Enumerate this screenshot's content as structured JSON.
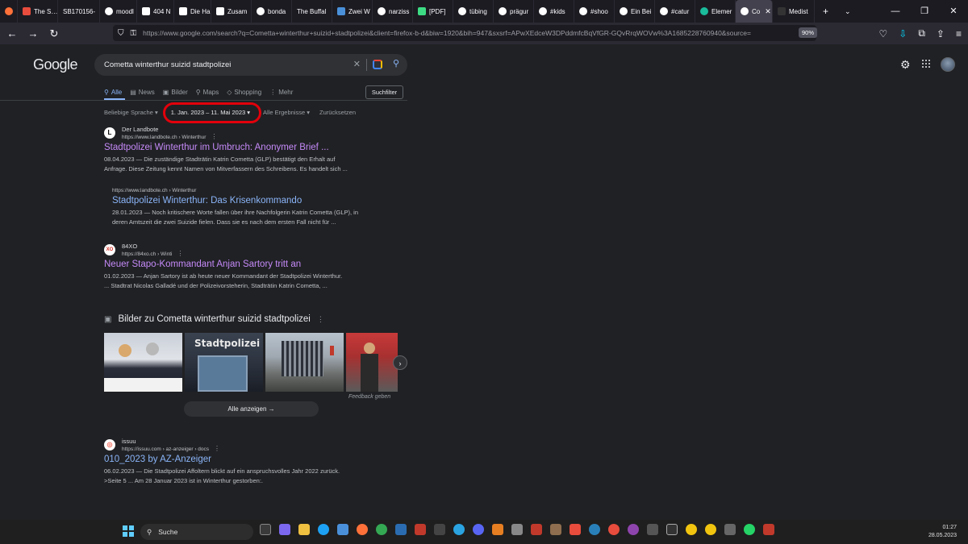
{
  "browser": {
    "tabs": [
      {
        "label": "The S… WIEDER",
        "color": "#e84c3d"
      },
      {
        "label": "SB170156-",
        "color": "#9aa0a6"
      },
      {
        "label": "moodl",
        "color": "#ffffff"
      },
      {
        "label": "404 N",
        "color": "#ffffff"
      },
      {
        "label": "Die Ha",
        "color": "#ffffff"
      },
      {
        "label": "Zusam",
        "color": "#ffffff"
      },
      {
        "label": "bonda",
        "color": "#ffffff"
      },
      {
        "label": "The Buffal",
        "color": "#9aa0a6"
      },
      {
        "label": "Zwei W",
        "color": "#4a90d9"
      },
      {
        "label": "narziss",
        "color": "#ffffff"
      },
      {
        "label": "[PDF]",
        "color": "#3ddc84"
      },
      {
        "label": "tübing",
        "color": "#ffffff"
      },
      {
        "label": "prägur",
        "color": "#ffffff"
      },
      {
        "label": "#kids",
        "color": "#ffffff"
      },
      {
        "label": "#shoo",
        "color": "#ffffff"
      },
      {
        "label": "Ein Bei",
        "color": "#ffffff"
      },
      {
        "label": "#catur",
        "color": "#ffffff"
      },
      {
        "label": "Elemer",
        "color": "#1abc9c"
      },
      {
        "label": "Co",
        "color": "#ffffff"
      },
      {
        "label": "Medist",
        "color": "#333333"
      }
    ],
    "url": "https://www.google.com/search?q=Cometta+winterthur+suizid+stadtpolizei&client=firefox-b-d&biw=1920&bih=947&sxsrf=APwXEdceW3DPddmfcBqVfGR-GQvRrqWOVw%3A1685228760940&source=",
    "zoom": "90%"
  },
  "google": {
    "logo": "Google",
    "query": "Cometta winterthur suizid stadtpolizei",
    "tabs": [
      "Alle",
      "News",
      "Bilder",
      "Maps",
      "Shopping",
      "Mehr"
    ],
    "suchfilter": "Suchfilter",
    "filters": {
      "language": "Beliebige Sprache ▾",
      "date": "1. Jan. 2023 – 11. Mai 2023 ▾",
      "results": "Alle Ergebnisse ▾",
      "reset": "Zurücksetzen"
    }
  },
  "results": [
    {
      "source": "Der Landbote",
      "url": "https://www.landbote.ch › Winterthur",
      "title": "Stadtpolizei Winterthur im Umbruch: Anonymer Brief ...",
      "snippet_line1": "08.04.2023 — Die zuständige Stadträtin Katrin Cometta (GLP) bestätigt den Erhalt auf",
      "snippet_line2": "Anfrage. Diese Zeitung kennt Namen von Mitverfassern des Schreibens. Es handelt sich ..."
    },
    {
      "url": "https://www.landbote.ch › Winterthur",
      "title": "Stadtpolizei Winterthur: Das Krisenkommando",
      "snippet_line1": "28.01.2023 — Noch kritischere Worte fallen über ihre Nachfolgerin Katrin Cometta (GLP), in",
      "snippet_line2": "deren Amtszeit die zwei Suizide fielen. Dass sie es nach dem ersten Fall nicht für ..."
    },
    {
      "source": "84XO",
      "url": "https://84xo.ch › Winti",
      "title": "Neuer Stapo-Kommandant Anjan Sartory tritt an",
      "snippet_line1": "01.02.2023 — Anjan Sartory ist ab heute neuer Kommandant der Stadtpolizei Winterthur.",
      "snippet_line2": "... Stadtrat Nicolas Galladé und der Polizeivorsteherin, Stadträtin Katrin Cometta, ..."
    },
    {
      "source": "issuu",
      "url": "https://issuu.com › az-anzeiger › docs",
      "title": "010_2023 by AZ-Anzeiger",
      "snippet_line1": "06.02.2023 — Die Stadtpolizei Affoltern blickt auf ein anspruchsvolles Jahr 2022 zurück.",
      "snippet_line2": ">Seite 5 ... Am 28 Januar 2023 ist in Winterthur gestorben:."
    }
  ],
  "images": {
    "heading": "Bilder zu Cometta winterthur suizid stadtpolizei",
    "thumbnail_text": "Stadtpolizei",
    "feedback": "Feedback geben",
    "show_all": "Alle anzeigen"
  },
  "taskbar": {
    "search": "Suche",
    "time": "01:27",
    "date": "28.05.2023"
  },
  "colors": {
    "highlight": "#e3000b",
    "visited_link": "#c58af9",
    "link": "#8ab4f8"
  }
}
